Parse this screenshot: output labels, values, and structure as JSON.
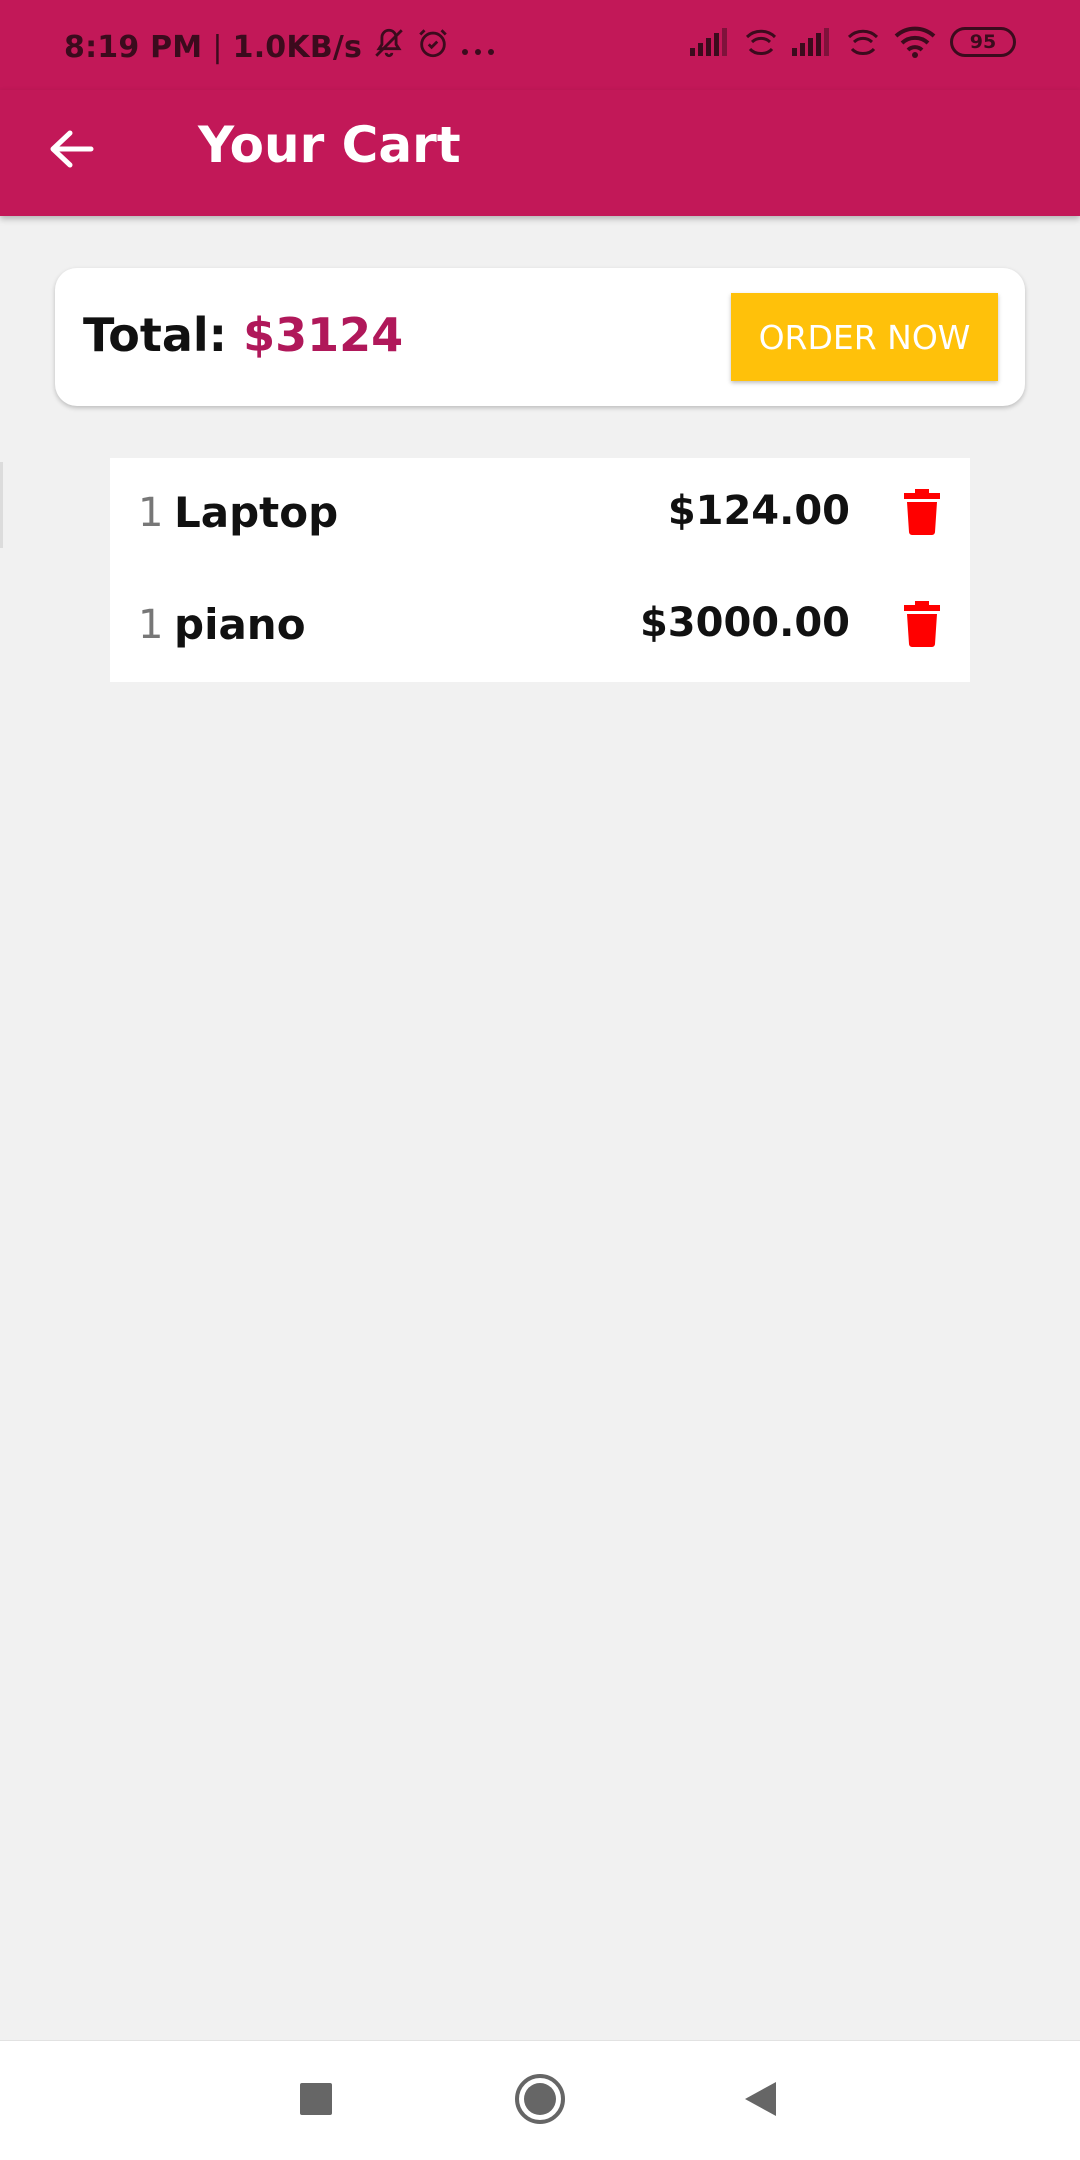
{
  "status_bar": {
    "time": "8:19 PM",
    "separator": "|",
    "network_speed": "1.0KB/s",
    "battery": "95",
    "icons": [
      "bell-off-icon",
      "alarm-icon",
      "more-dots-icon",
      "signal-icon",
      "wifi-calling-icon",
      "signal-icon",
      "wifi-calling-icon",
      "wifi-icon",
      "battery-icon"
    ]
  },
  "app_bar": {
    "title": "Your Cart",
    "back_icon": "arrow-left-icon"
  },
  "summary": {
    "total_label": "Total:",
    "total_value": "$3124",
    "order_button": "ORDER NOW"
  },
  "cart": {
    "items": [
      {
        "qty": "1",
        "name": "Laptop",
        "price": "$124.00"
      },
      {
        "qty": "1",
        "name": "piano",
        "price": "$3000.00"
      }
    ],
    "delete_icon": "trash-icon"
  },
  "colors": {
    "primary": "#c21858",
    "accent": "#ffc10a",
    "total_value": "#b0185a",
    "delete": "#ff0000"
  },
  "nav_bar": {
    "icons": [
      "recent-apps-icon",
      "home-icon",
      "back-icon"
    ]
  }
}
